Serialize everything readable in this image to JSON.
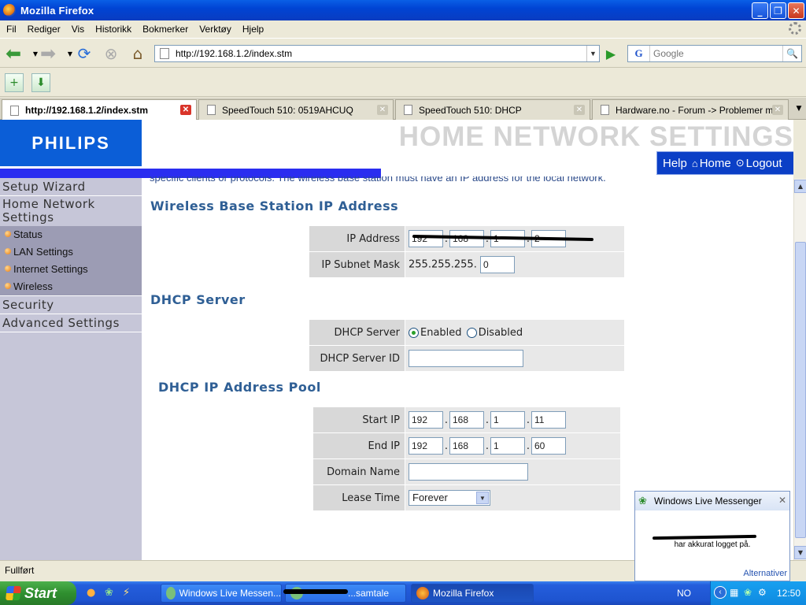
{
  "window": {
    "title": "Mozilla Firefox"
  },
  "menu": [
    "Fil",
    "Rediger",
    "Vis",
    "Historikk",
    "Bokmerker",
    "Verktøy",
    "Hjelp"
  ],
  "nav": {
    "url": "http://192.168.1.2/index.stm",
    "search_placeholder": "Google",
    "search_engine_icon": "G"
  },
  "tabs": [
    {
      "label": "http://192.168.1.2/index.stm",
      "active": true
    },
    {
      "label": "SpeedTouch 510:  0519AHCUQ",
      "active": false
    },
    {
      "label": "SpeedTouch 510:  DHCP",
      "active": false
    },
    {
      "label": "Hardware.no - Forum -> Problemer m...",
      "active": false
    }
  ],
  "page": {
    "brand": "PHILIPS",
    "banner": "HOME NETWORK SETTINGS",
    "topnav": {
      "help": "Help",
      "home": "Home",
      "logout": "Logout"
    },
    "cut_text": "specific clients or protocols. The wireless base station must have an IP address for the local network.",
    "sidebar": {
      "setup_wizard": "Setup Wizard",
      "home_network": "Home Network Settings",
      "sub": [
        "Status",
        "LAN Settings",
        "Internet Settings",
        "Wireless"
      ],
      "security": "Security",
      "advanced": "Advanced Settings"
    },
    "wbs": {
      "heading": "Wireless Base Station IP Address",
      "ip_label": "IP Address",
      "ip": [
        "192",
        "168",
        "1",
        "2"
      ],
      "mask_label": "IP Subnet Mask",
      "mask_prefix": "255.255.255.",
      "mask_last": "0"
    },
    "dhcp": {
      "heading": "DHCP Server",
      "server_label": "DHCP Server",
      "enabled": "Enabled",
      "disabled": "Disabled",
      "id_label": "DHCP Server ID",
      "id_value": ""
    },
    "pool": {
      "heading": "DHCP IP Address Pool",
      "start_label": "Start IP",
      "start": [
        "192",
        "168",
        "1",
        "11"
      ],
      "end_label": "End IP",
      "end": [
        "192",
        "168",
        "1",
        "60"
      ],
      "domain_label": "Domain Name",
      "domain_value": "",
      "lease_label": "Lease Time",
      "lease_value": "Forever"
    }
  },
  "status": "Fullført",
  "messenger": {
    "title": "Windows Live Messenger",
    "message": "har akkurat logget på.",
    "options": "Alternativer"
  },
  "taskbar": {
    "start": "Start",
    "tasks": [
      "Windows Live Messen...",
      "...samtale",
      "Mozilla Firefox"
    ],
    "lang": "NO",
    "clock": "12:50"
  }
}
